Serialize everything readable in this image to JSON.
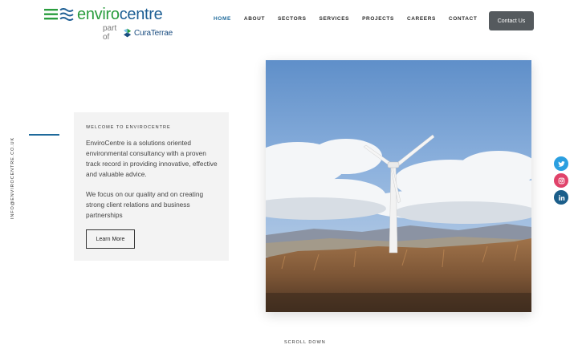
{
  "brand": {
    "name_part1": "enviro",
    "name_part2": "centre",
    "partof_label": "part of",
    "parent_name": "CuraTerrae"
  },
  "nav": {
    "items": [
      {
        "label": "HOME",
        "active": true
      },
      {
        "label": "ABOUT",
        "active": false
      },
      {
        "label": "SECTORS",
        "active": false
      },
      {
        "label": "SERVICES",
        "active": false
      },
      {
        "label": "PROJECTS",
        "active": false
      },
      {
        "label": "CAREERS",
        "active": false
      },
      {
        "label": "CONTACT",
        "active": false
      }
    ],
    "contact_button": "Contact Us"
  },
  "side": {
    "email": "INFO@ENVIROCENTRE.CO.UK"
  },
  "intro": {
    "eyebrow": "WELCOME TO ENVIROCENTRE",
    "paragraph1": "EnviroCentre is a solutions oriented environmental consultancy with a proven track record in providing innovative, effective and valuable advice.",
    "paragraph2": "We focus on our quality and on creating strong client relations and business partnerships",
    "button": "Learn More"
  },
  "hero": {
    "image": "wind-turbine-on-moorland"
  },
  "social": [
    {
      "icon": "twitter-icon",
      "color": "#2b9fe0"
    },
    {
      "icon": "instagram-icon",
      "color": "#e0436a"
    },
    {
      "icon": "linkedin-icon",
      "color": "#1b5e8a"
    }
  ],
  "scroll_label": "SCROLL DOWN",
  "colors": {
    "accent": "#1e6a9b",
    "green": "#2a9d3e",
    "button_dark": "#555a5e"
  }
}
